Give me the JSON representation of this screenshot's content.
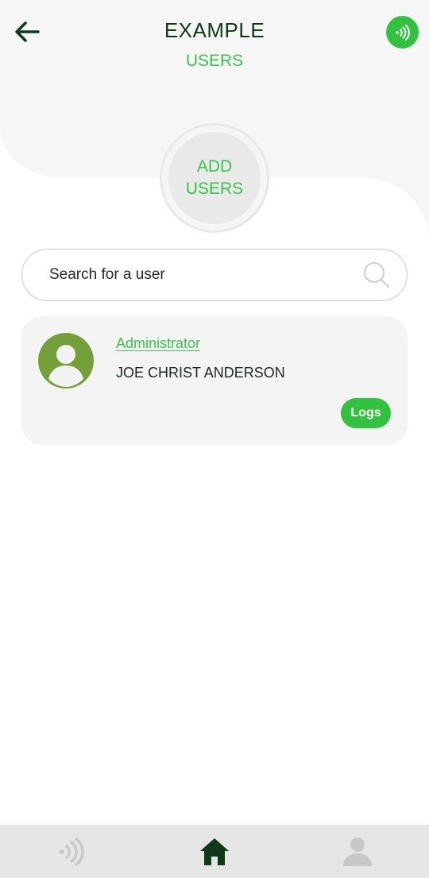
{
  "header": {
    "title": "EXAMPLE",
    "subtitle": "USERS"
  },
  "add_users": {
    "line1": "ADD",
    "line2": "USERS"
  },
  "search": {
    "placeholder": "Search for a user",
    "value": ""
  },
  "users": [
    {
      "role": "Administrator",
      "name": "JOE CHRIST ANDERSON",
      "logs_label": "Logs"
    }
  ],
  "bottom_nav": {
    "items": [
      {
        "icon": "nfc-icon",
        "active": false
      },
      {
        "icon": "home-icon",
        "active": true
      },
      {
        "icon": "profile-icon",
        "active": false
      }
    ]
  },
  "colors": {
    "accent": "#33c23f",
    "dark_green": "#0f3a17",
    "avatar": "#74a03a"
  }
}
